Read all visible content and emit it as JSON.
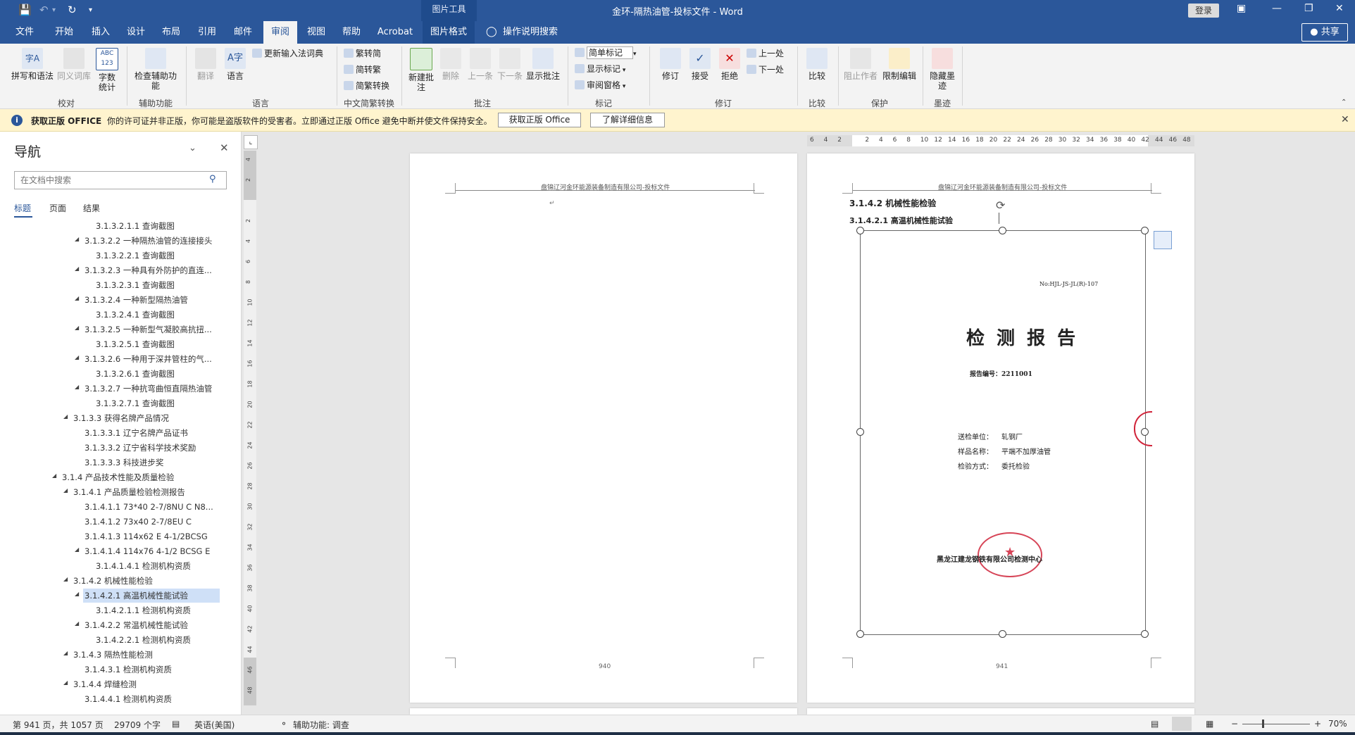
{
  "titlebar": {
    "context_tab": "图片工具",
    "doc_title": "金环-隔热油管-投标文件  -  Word",
    "login": "登录",
    "share": "共享"
  },
  "menu": {
    "tabs": [
      "文件",
      "开始",
      "插入",
      "设计",
      "布局",
      "引用",
      "邮件",
      "审阅",
      "视图",
      "帮助",
      "Acrobat",
      "图片格式"
    ],
    "active_tab": "审阅",
    "tell_me": "操作说明搜索"
  },
  "ribbon": {
    "groups": [
      "校对",
      "辅助功能",
      "语言",
      "中文简繁转换",
      "批注",
      "标记",
      "修订",
      "比较",
      "保护",
      "墨迹"
    ],
    "spelling": "拼写和语法",
    "thesaurus": "同义词库",
    "word_count": "字数统计",
    "check_accessibility": "检查辅助功能",
    "translate": "翻译",
    "language": "语言",
    "update_ime": "更新输入法词典",
    "trad_to_simp": "繁转简",
    "simp_to_trad": "简转繁",
    "simp_trad_convert": "简繁转换",
    "new_comment": "新建批注",
    "delete": "删除",
    "previous": "上一条",
    "next": "下一条",
    "show_comments": "显示批注",
    "markup_select": "简单标记",
    "show_markup": "显示标记",
    "review_pane": "审阅窗格",
    "track_changes": "修订",
    "accept": "接受",
    "reject": "拒绝",
    "prev_change": "上一处",
    "next_change": "下一处",
    "compare": "比较",
    "block_authors": "阻止作者",
    "restrict_editing": "限制编辑",
    "hide_ink": "隐藏墨迹"
  },
  "warning": {
    "title": "获取正版 OFFICE",
    "message": "你的许可证并非正版，你可能是盗版软件的受害者。立即通过正版 Office 避免中断并使文件保持安全。",
    "btn_get": "获取正版 Office",
    "btn_more": "了解详细信息"
  },
  "nav": {
    "title": "导航",
    "search_placeholder": "在文档中搜索",
    "tabs": [
      "标题",
      "页面",
      "结果"
    ],
    "items": [
      "3.1.3.2.1.1 查询截图",
      "3.1.3.2.2 一种隔热油管的连接接头",
      "3.1.3.2.2.1 查询截图",
      "3.1.3.2.3 一种具有外防护的直连...",
      "3.1.3.2.3.1 查询截图",
      "3.1.3.2.4 一种新型隔热油管",
      "3.1.3.2.4.1 查询截图",
      "3.1.3.2.5 一种新型气凝胶高抗扭...",
      "3.1.3.2.5.1 查询截图",
      "3.1.3.2.6 一种用于深井管柱的气...",
      "3.1.3.2.6.1 查询截图",
      "3.1.3.2.7 一种抗弯曲恒直隔热油管",
      "3.1.3.2.7.1 查询截图",
      "3.1.3.3 获得名牌产品情况",
      "3.1.3.3.1 辽宁名牌产品证书",
      "3.1.3.3.2 辽宁省科学技术奖励",
      "3.1.3.3.3 科技进步奖",
      "3.1.4 产品技术性能及质量检验",
      "3.1.4.1 产品质量检验检测报告",
      "3.1.4.1.1 73*40 2-7/8NU C N8...",
      "3.1.4.1.2 73x40 2-7/8EU C",
      "3.1.4.1.3 114x62 E 4-1/2BCSG",
      "3.1.4.1.4 114x76 4-1/2 BCSG E",
      "3.1.4.1.4.1 检测机构资质",
      "3.1.4.2 机械性能检验",
      "3.1.4.2.1 高温机械性能试验",
      "3.1.4.2.1.1 检测机构资质",
      "3.1.4.2.2 常温机械性能试验",
      "3.1.4.2.2.1 检测机构资质",
      "3.1.4.3 隔热性能检测",
      "3.1.4.3.1 检测机构资质",
      "3.1.4.4 焊缝检测",
      "3.1.4.4.1 检测机构资质"
    ]
  },
  "document": {
    "header_text": "盘锦辽河金环能源装备制造有限公司-投标文件",
    "left_page_number": "940",
    "right_page_number": "941",
    "heading_1": "3.1.4.2 机械性能检验",
    "heading_2": "3.1.4.2.1 高温机械性能试验",
    "report": {
      "code": "No:HJL-JS-JL(R)-107",
      "title": "检 测 报 告",
      "number": "报告编号：2211001",
      "client_label": "送检单位：",
      "client_value": "轧钢厂",
      "sample_label": "样品名称：",
      "sample_value": "平端不加厚油管",
      "method_label": "检验方式：",
      "method_value": "委托检验",
      "org": "黑龙江建龙钢铁有限公司检测中心"
    }
  },
  "status": {
    "page": "第 941 页，共 1057 页",
    "words": "29709 个字",
    "language": "英语(美国)",
    "accessibility": "辅助功能: 调查",
    "zoom": "70%"
  },
  "colors": {
    "brand": "#2b579a",
    "warning_bg": "#fff4ce",
    "stamp": "#d0243a"
  }
}
